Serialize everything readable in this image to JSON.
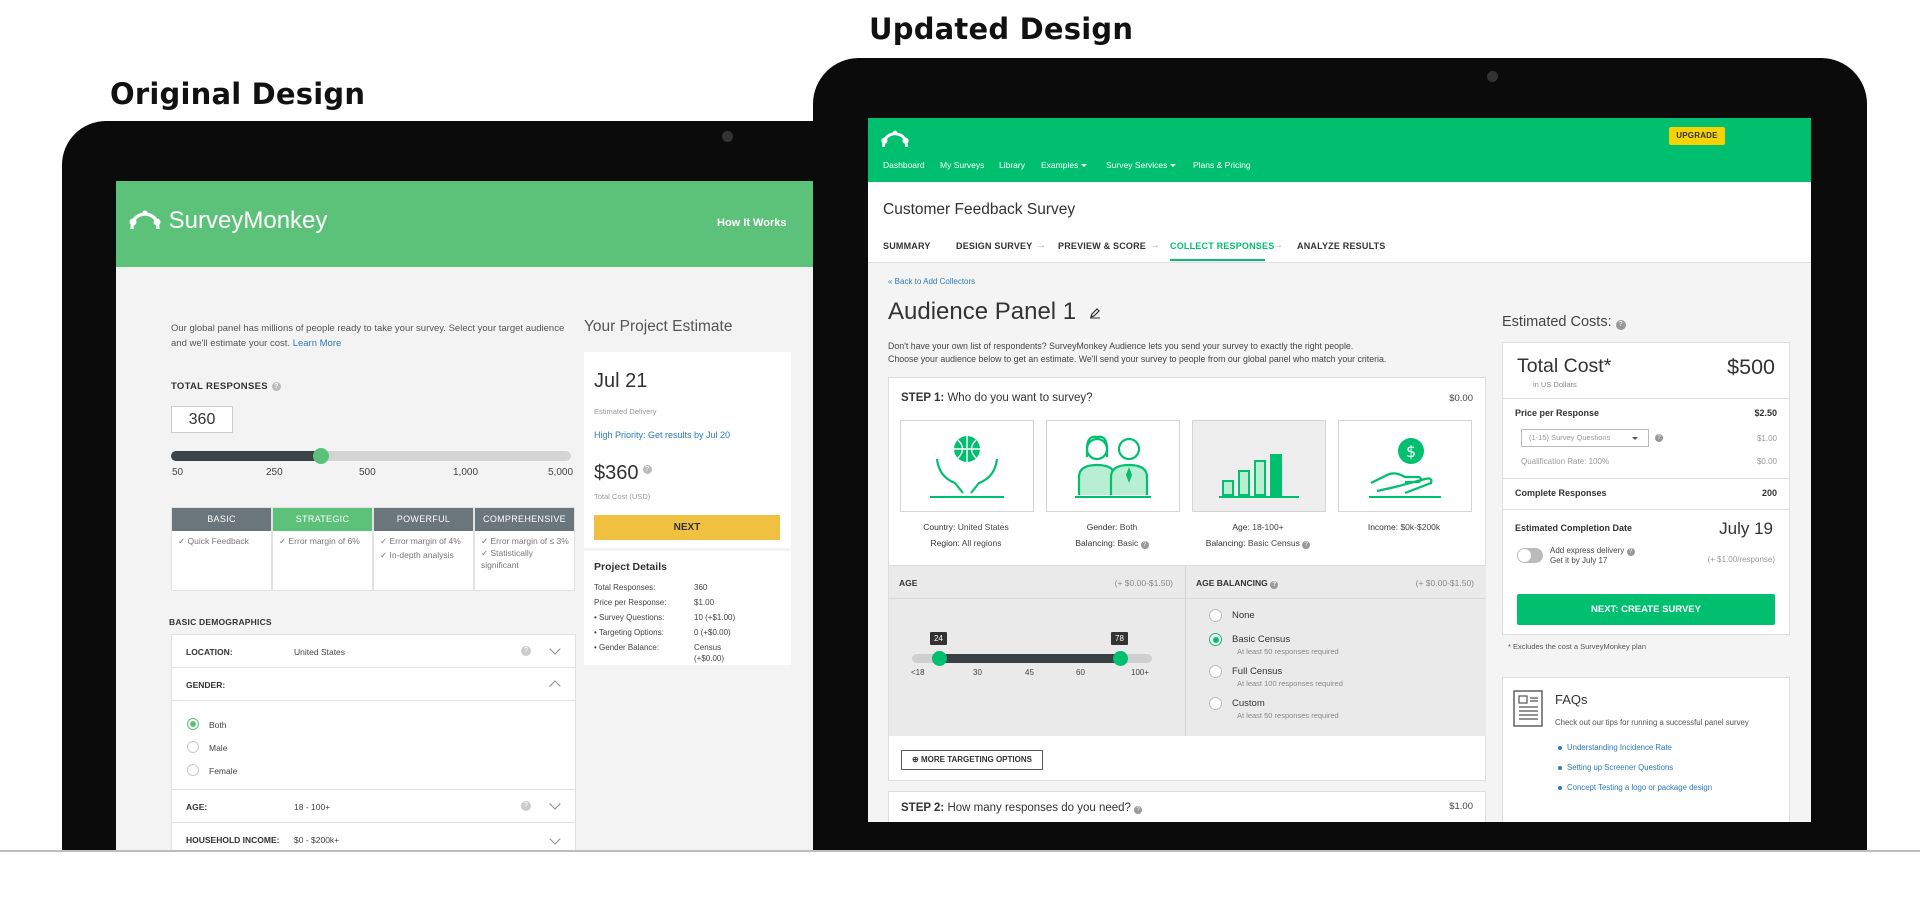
{
  "headings": {
    "original": "Original Design",
    "updated": "Updated Design"
  },
  "original": {
    "brand": "SurveyMonkey",
    "how_it_works": "How It Works",
    "intro": "Our global panel has millions of people ready to take your survey. Select your target audience and we'll estimate your cost.",
    "learn_more": "Learn More",
    "total_responses_label": "TOTAL RESPONSES",
    "total_responses_value": "360",
    "slider_ticks": [
      "50",
      "250",
      "500",
      "1,000",
      "5,000"
    ],
    "slider_fraction": 0.375,
    "plans": [
      {
        "name": "BASIC",
        "features": [
          "Quick Feedback"
        ]
      },
      {
        "name": "STRATEGIC",
        "features": [
          "Error margin of 6%"
        ]
      },
      {
        "name": "POWERFUL",
        "features": [
          "Error margin of 4%",
          "In-depth analysis"
        ]
      },
      {
        "name": "COMPREHENSIVE",
        "features": [
          "Error margin of ≤ 3%",
          "Statistically significant"
        ]
      }
    ],
    "demographics_label": "BASIC DEMOGRAPHICS",
    "demographics": {
      "location_label": "LOCATION:",
      "location_value": "United States",
      "gender_label": "GENDER:",
      "gender_options": [
        "Both",
        "Male",
        "Female"
      ],
      "gender_selected": "Both",
      "age_label": "AGE:",
      "age_value": "18 - 100+",
      "income_label": "HOUSEHOLD INCOME:",
      "income_value": "$0 - $200k+"
    },
    "estimate": {
      "title": "Your Project Estimate",
      "date": "Jul 21",
      "delivery_label": "Estimated Delivery",
      "priority": "High Priority: Get results by Jul 20",
      "price": "$360",
      "price_label": "Total Cost (USD)",
      "next": "NEXT"
    },
    "details": {
      "title": "Project Details",
      "rows": [
        {
          "k": "Total Responses:",
          "v": "360"
        },
        {
          "k": "Price per Response:",
          "v": "$1.00"
        },
        {
          "k": "• Survey Questions:",
          "v": "10 (+$1.00)"
        },
        {
          "k": "• Targeting Options:",
          "v": "0 (+$0.00)"
        },
        {
          "k": "• Gender Balance:",
          "v": "Census"
        },
        {
          "k": "",
          "v": "(+$0.00)"
        }
      ]
    }
  },
  "updated": {
    "upgrade": "UPGRADE",
    "nav": [
      "Dashboard",
      "My Surveys",
      "Library",
      "Examples",
      "Survey Services",
      "Plans & Pricing"
    ],
    "survey_title": "Customer Feedback Survey",
    "steps": [
      "SUMMARY",
      "DESIGN SURVEY",
      "PREVIEW & SCORE",
      "COLLECT RESPONSES",
      "ANALYZE RESULTS"
    ],
    "active_step": "COLLECT RESPONSES",
    "back_link": "« Back to Add Collectors",
    "panel_title": "Audience Panel 1",
    "description_1": "Don't have your own list of respondents? SurveyMonkey Audience lets you send your survey to exactly the right people.",
    "description_2": "Choose your audience below to get an estimate. We'll send your survey to people from our global panel who match your criteria.",
    "step1_prefix": "STEP 1:",
    "step1_text": "Who do you want to survey?",
    "step1_cost": "$0.00",
    "tiles": [
      {
        "icon": "globe-hands-icon",
        "line1_k": "Country:",
        "line1_v": "United States",
        "line2_k": "Region:",
        "line2_v": "All regions"
      },
      {
        "icon": "people-icon",
        "line1_k": "Gender:",
        "line1_v": "Both",
        "line2_k": "Balancing:",
        "line2_v": "Basic"
      },
      {
        "icon": "bar-chart-icon",
        "line1_k": "Age:",
        "line1_v": "18-100+",
        "line2_k": "Balancing:",
        "line2_v": "Basic Census"
      },
      {
        "icon": "money-hand-icon",
        "line1_k": "Income:",
        "line1_v": "$0k-$200k",
        "line2_k": "",
        "line2_v": ""
      }
    ],
    "age": {
      "label": "AGE",
      "range": "(+ $0.00-$1.50)",
      "low": "24",
      "high": "78",
      "ticks": [
        "<18",
        "30",
        "45",
        "60",
        "100+"
      ]
    },
    "balancing": {
      "label": "AGE BALANCING",
      "range": "(+ $0.00-$1.50)",
      "options": [
        {
          "label": "None",
          "sub": ""
        },
        {
          "label": "Basic Census",
          "sub": "At least 50 responses required"
        },
        {
          "label": "Full Census",
          "sub": "At least 100 responses required"
        },
        {
          "label": "Custom",
          "sub": "At least 50 responses required"
        }
      ],
      "selected": "Basic Census"
    },
    "more_targeting": "MORE TARGETING OPTIONS",
    "step2_prefix": "STEP 2:",
    "step2_text": "How many responses do you need?",
    "step2_cost": "$1.00",
    "costs": {
      "label": "Estimated Costs:",
      "total_label": "Total Cost*",
      "total_value": "$500",
      "currency_note": "in US Dollars",
      "ppr_label": "Price per Response",
      "ppr_value": "$2.50",
      "questions_select": "(1-15) Survey Questions",
      "questions_value": "$1.00",
      "qualification": "Qualification Rate: 100%",
      "qualification_value": "$0.00",
      "complete_label": "Complete Responses",
      "complete_value": "200",
      "completion_label": "Estimated Completion Date",
      "completion_value": "July 19",
      "express_line1": "Add express delivery",
      "express_line2": "Get it by July 17",
      "express_cost": "(+ $1.00/response)",
      "create_button": "NEXT: CREATE SURVEY",
      "footnote": "* Excludes the cost a SurveyMonkey plan"
    },
    "faq": {
      "title": "FAQs",
      "desc": "Check out our tips for running a successful panel survey",
      "links": [
        "Understanding Incidence Rate",
        "Setting up Screener Questions",
        "Concept Testing a logo or package design"
      ]
    }
  }
}
